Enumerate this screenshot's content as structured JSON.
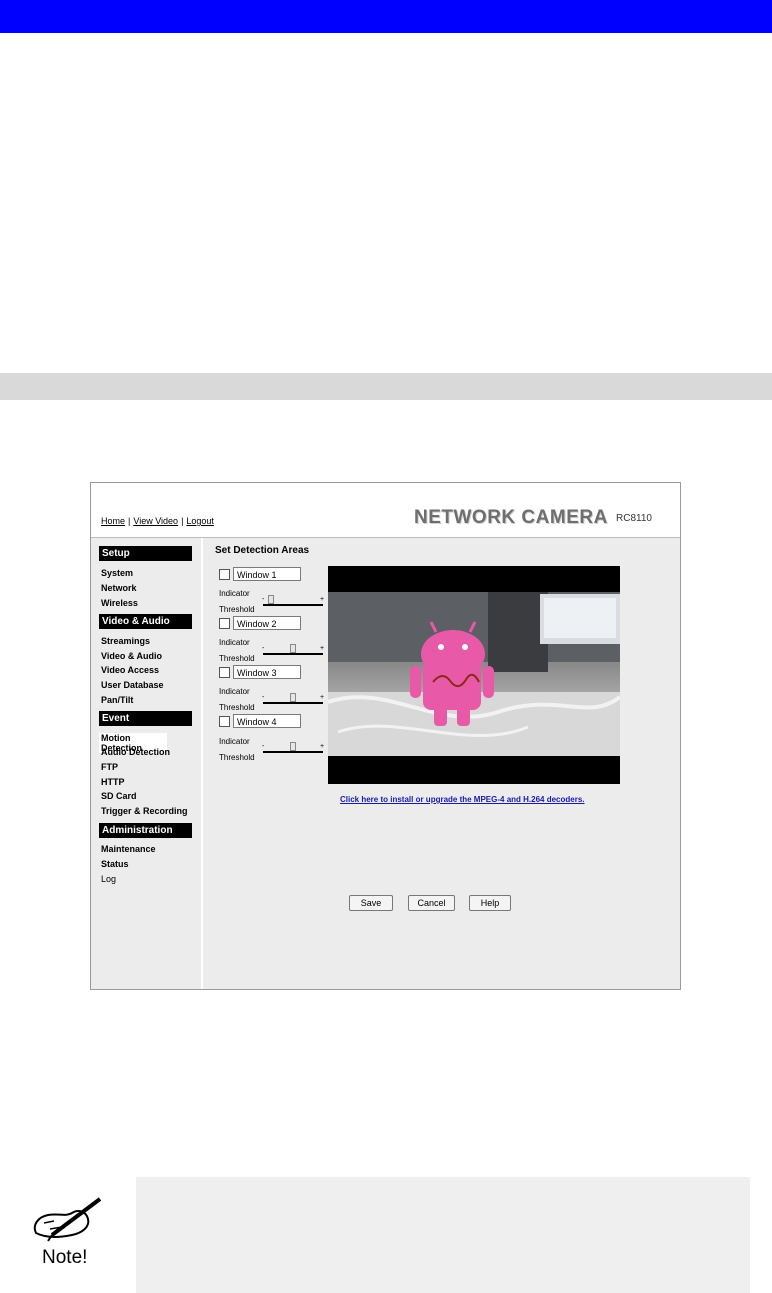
{
  "camera_ui": {
    "nav": {
      "home": "Home",
      "view_video": "View Video",
      "logout": "Logout",
      "separator": "|"
    },
    "brand": "NETWORK CAMERA",
    "model": "RC8110",
    "sidebar": {
      "setup": {
        "heading": "Setup",
        "items": [
          "System",
          "Network",
          "Wireless"
        ]
      },
      "video_audio": {
        "heading": "Video & Audio",
        "items": [
          "Streamings",
          "Video & Audio",
          "Video Access",
          "User Database",
          "Pan/Tilt"
        ]
      },
      "event": {
        "heading": "Event",
        "items": [
          "Motion Detection",
          "Audio Detection",
          "FTP",
          "HTTP",
          "SD Card",
          "Trigger & Recording"
        ]
      },
      "administration": {
        "heading": "Administration",
        "items": [
          "Maintenance",
          "Status",
          "Log"
        ]
      }
    },
    "main": {
      "title": "Set Detection Areas",
      "windows": [
        {
          "name": "Window 1",
          "indicator_label": "Indicator",
          "threshold_label": "Threshold",
          "threshold_level": 0.1
        },
        {
          "name": "Window 2",
          "indicator_label": "Indicator",
          "threshold_label": "Threshold",
          "threshold_level": 0.5
        },
        {
          "name": "Window 3",
          "indicator_label": "Indicator",
          "threshold_label": "Threshold",
          "threshold_level": 0.5
        },
        {
          "name": "Window 4",
          "indicator_label": "Indicator",
          "threshold_label": "Threshold",
          "threshold_level": 0.5
        }
      ],
      "slider_minus": "-",
      "slider_plus": "+",
      "decoder_link": "Click here to install or upgrade the MPEG-4 and H.264 decoders.",
      "buttons": {
        "save": "Save",
        "cancel": "Cancel",
        "help": "Help"
      }
    }
  },
  "note": {
    "label": "Note!"
  },
  "colors": {
    "top_bar": "#0000ff",
    "link": "#1a1aa8",
    "section_head": "#000000"
  }
}
